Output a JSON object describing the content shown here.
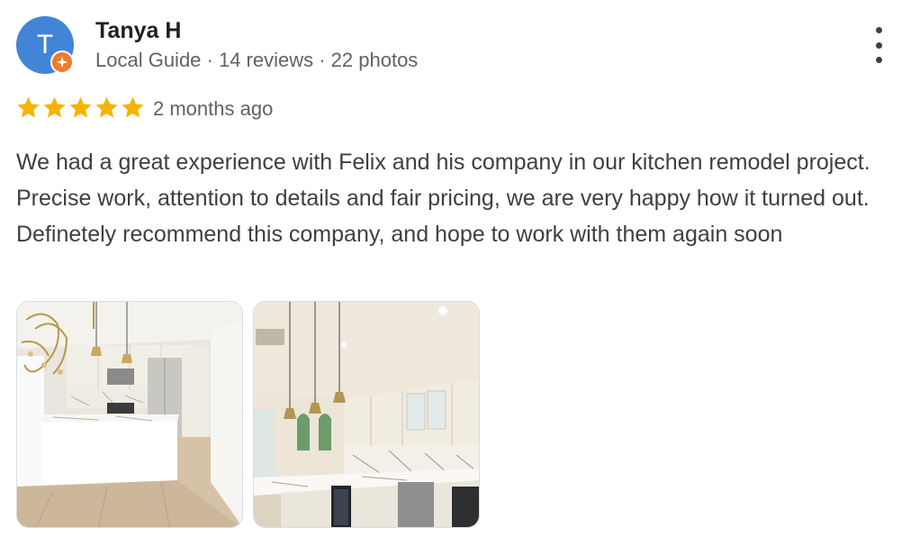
{
  "reviewer": {
    "avatar_initial": "T",
    "avatar_color": "#4285d6",
    "badge_color": "#f07a2c",
    "name": "Tanya H",
    "meta": "Local Guide · 14 reviews · 22 photos"
  },
  "rating": {
    "stars": 5,
    "max": 5,
    "star_color": "#f4b400"
  },
  "time_ago": "2 months ago",
  "review_text": "We had a great experience with Felix and his company in our kitchen remodel project. Precise work, attention to details and fair pricing, we are very happy how it turned out. Definetely recommend this company, and hope to work with them again soon",
  "menu_icon": "more-vert-icon",
  "photos": [
    {
      "icon": "kitchen-photo-1"
    },
    {
      "icon": "kitchen-photo-2"
    }
  ]
}
